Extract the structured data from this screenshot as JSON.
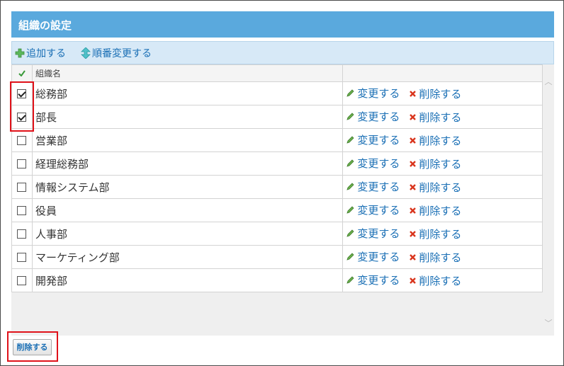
{
  "title": "組織の設定",
  "toolbar": {
    "add_label": "追加する",
    "order_label": "順番変更する"
  },
  "table": {
    "header_check_icon": "check-icon",
    "column_name_header": "組織名",
    "change_label": "変更する",
    "delete_label": "削除する",
    "rows": [
      {
        "name": "総務部",
        "checked": true
      },
      {
        "name": "部長",
        "checked": true
      },
      {
        "name": "営業部",
        "checked": false
      },
      {
        "name": "経理総務部",
        "checked": false
      },
      {
        "name": "情報システム部",
        "checked": false
      },
      {
        "name": "役員",
        "checked": false
      },
      {
        "name": "人事部",
        "checked": false
      },
      {
        "name": "マーケティング部",
        "checked": false
      },
      {
        "name": "開発部",
        "checked": false
      }
    ]
  },
  "footer": {
    "delete_button_label": "削除する"
  },
  "colors": {
    "title_bg": "#5aa9dd",
    "toolbar_bg": "#d7e9f7",
    "link": "#1a6fb5",
    "highlight": "#e0121a"
  }
}
